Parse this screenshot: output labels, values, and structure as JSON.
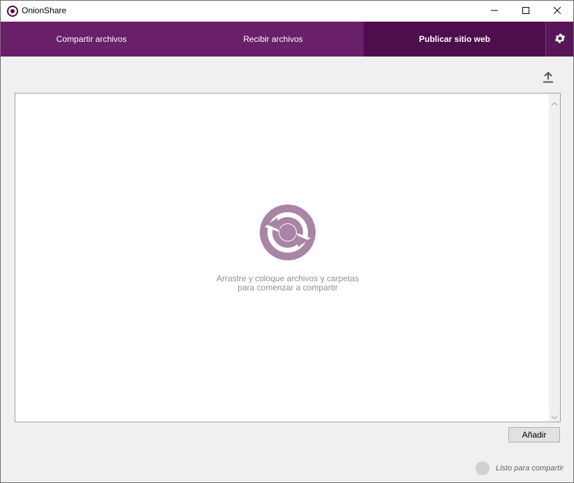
{
  "window": {
    "title": "OnionShare",
    "brand_color": "#6a1f69",
    "brand_color_dark": "#4e0d4d"
  },
  "titlebar_buttons": {
    "minimize_icon": "minimize-icon",
    "maximize_icon": "maximize-icon",
    "close_icon": "close-icon"
  },
  "tabs": [
    {
      "label": "Compartir archivos",
      "active": false
    },
    {
      "label": "Recibir archivos",
      "active": false
    },
    {
      "label": "Publicar sitio web",
      "active": true
    }
  ],
  "settings": {
    "icon": "gear-icon"
  },
  "toolbar": {
    "upload_icon": "upload-icon"
  },
  "drop_zone": {
    "line1": "Arrastre y coloque archivos y carpetas",
    "line2": "para comenzar a compartir",
    "logo_color": "#a984a5"
  },
  "buttons": {
    "add_label": "Añadir"
  },
  "status": {
    "text": "Listo para compartir",
    "indicator_color": "#d0d0d0"
  }
}
